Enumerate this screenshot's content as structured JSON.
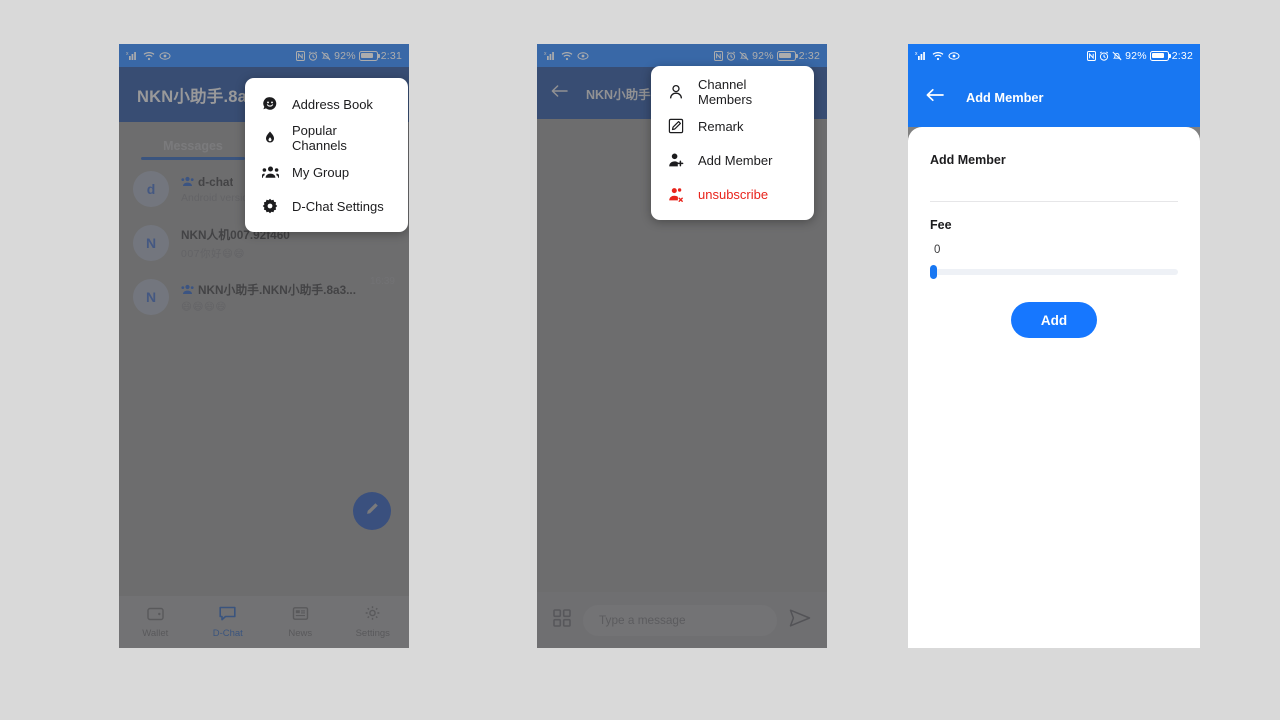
{
  "page": {
    "background": "#d9d9d9"
  },
  "colors": {
    "status_blue": "#1877f2",
    "header_dark_blue": "#16418a",
    "accent_blue": "#1677ff",
    "danger_red": "#e8241c",
    "scrim_gray": "#808080"
  },
  "phone1": {
    "statusbar": {
      "signal_icon": "signal-bars-icon",
      "wifi_icon": "wifi-icon",
      "eye_icon": "eye-care-icon",
      "nfc_icon": "nfc-icon",
      "alarm_icon": "alarm-clock-icon",
      "mute_icon": "bell-muted-icon",
      "battery_percent": "92%",
      "battery_icon": "battery-icon",
      "time": "2:31"
    },
    "header": {
      "title": "NKN小助手.8a"
    },
    "tabs": [
      {
        "label": "Messages",
        "active": true
      }
    ],
    "chats": [
      {
        "avatar": "d",
        "group_icon": "group-icon",
        "is_group": true,
        "title": "d-chat",
        "preview": "Android versio",
        "time": ""
      },
      {
        "avatar": "N",
        "group_icon": "",
        "is_group": false,
        "title": "NKN人机007.92f460",
        "preview": "007你好😄😄",
        "time": "11:08"
      },
      {
        "avatar": "N",
        "group_icon": "group-icon",
        "is_group": true,
        "title": "NKN小助手.NKN小助手.8a3...",
        "preview": "😄😄😄😄",
        "time": "16:39"
      }
    ],
    "fab": {
      "icon": "pencil-icon"
    },
    "menu": {
      "items": [
        {
          "icon": "address-book-smiley-icon",
          "label": "Address Book",
          "danger": false
        },
        {
          "icon": "fire-drop-icon",
          "label": "Popular Channels",
          "danger": false
        },
        {
          "icon": "group-people-icon",
          "label": "My Group",
          "danger": false
        },
        {
          "icon": "gear-icon",
          "label": "D-Chat Settings",
          "danger": false
        }
      ]
    },
    "bottom_nav": [
      {
        "icon": "wallet-icon",
        "label": "Wallet",
        "active": false
      },
      {
        "icon": "chat-icon",
        "label": "D-Chat",
        "active": true
      },
      {
        "icon": "news-icon",
        "label": "News",
        "active": false
      },
      {
        "icon": "settings-icon",
        "label": "Settings",
        "active": false
      }
    ]
  },
  "phone2": {
    "statusbar": {
      "battery_percent": "92%",
      "time": "2:32"
    },
    "header": {
      "back_icon": "back-arrow-icon",
      "title": "NKN小助手.N"
    },
    "menu": {
      "items": [
        {
          "icon": "person-outline-icon",
          "label": "Channel Members",
          "danger": false
        },
        {
          "icon": "edit-square-icon",
          "label": "Remark",
          "danger": false
        },
        {
          "icon": "person-add-icon",
          "label": "Add Member",
          "danger": false
        },
        {
          "icon": "person-remove-icon",
          "label": "unsubscribe",
          "danger": true
        }
      ]
    },
    "composer": {
      "grid_icon": "grid-apps-icon",
      "placeholder": "Type a message",
      "send_icon": "send-icon"
    }
  },
  "phone3": {
    "statusbar": {
      "battery_percent": "92%",
      "time": "2:32"
    },
    "header": {
      "back_icon": "back-arrow-icon",
      "title": "Add Member"
    },
    "form": {
      "member_label": "Add Member",
      "fee_label": "Fee",
      "fee_value": "0",
      "slider_position_percent": 0,
      "submit_label": "Add"
    }
  }
}
